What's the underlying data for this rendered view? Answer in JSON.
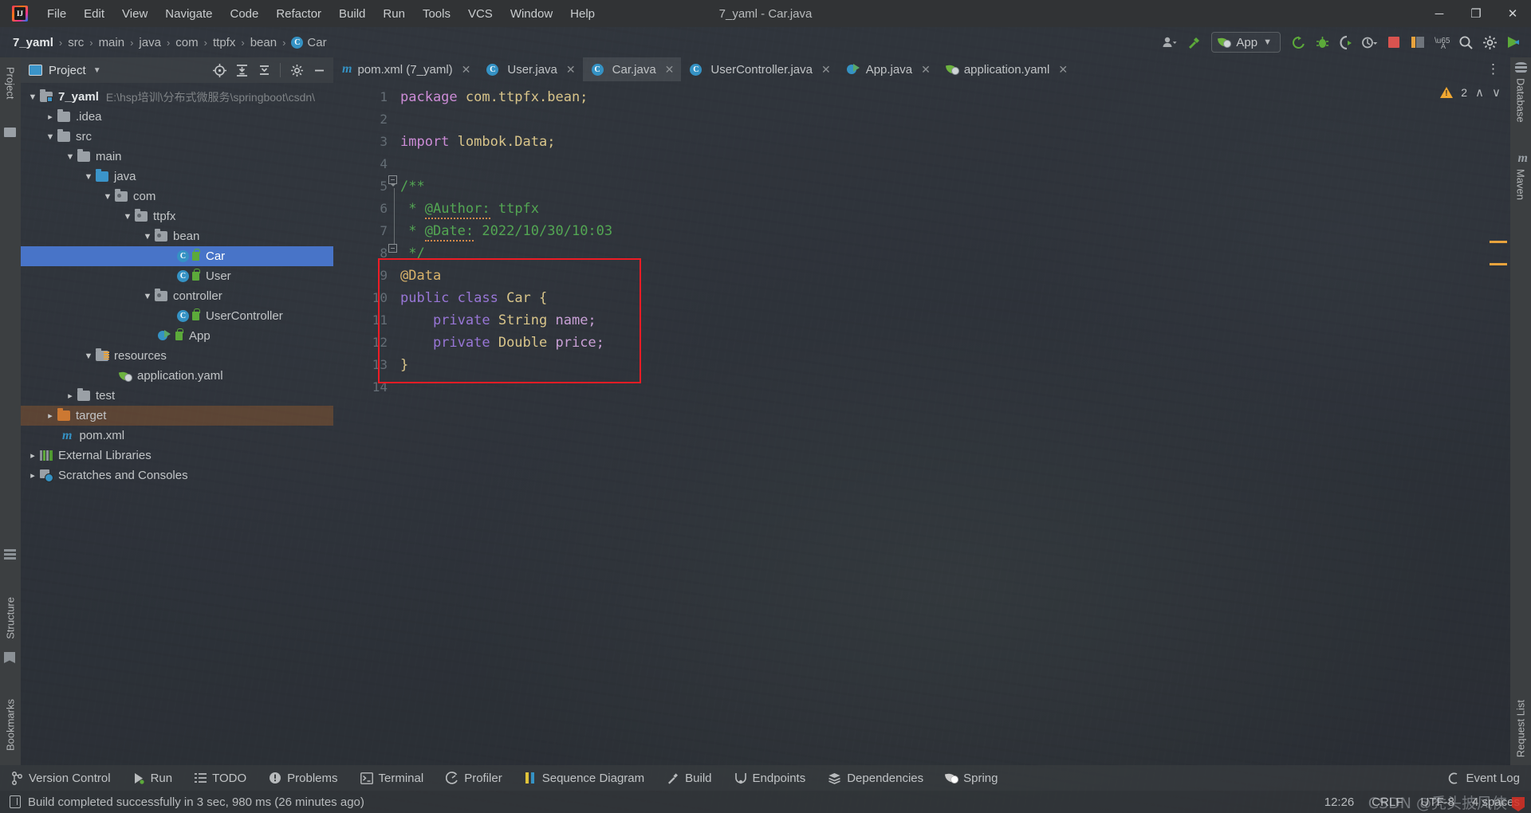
{
  "window": {
    "title": "7_yaml - Car.java",
    "logo_letters": "IJ",
    "minimize": "─",
    "maximize": "❐",
    "close": "✕"
  },
  "menu": [
    {
      "label": "File"
    },
    {
      "label": "Edit"
    },
    {
      "label": "View"
    },
    {
      "label": "Navigate"
    },
    {
      "label": "Code"
    },
    {
      "label": "Refactor"
    },
    {
      "label": "Build"
    },
    {
      "label": "Run"
    },
    {
      "label": "Tools"
    },
    {
      "label": "VCS"
    },
    {
      "label": "Window"
    },
    {
      "label": "Help"
    }
  ],
  "breadcrumb": {
    "sep": "›",
    "items": [
      "7_yaml",
      "src",
      "main",
      "java",
      "com",
      "ttpfx",
      "bean",
      "Car"
    ],
    "class_badge": "C"
  },
  "toolbar": {
    "run_config": "App",
    "dropdown_caret": "▼",
    "icons": [
      "user-avatar-icon",
      "hammer-build-icon",
      "rerun-icon",
      "debug-icon",
      "run-coverage-icon",
      "profile-dropdown-icon",
      "stop-icon",
      "layout-icon",
      "translate-icon",
      "search-everywhere-icon",
      "settings-icon",
      "updates-icon"
    ]
  },
  "left_strip": {
    "project": "Project",
    "structure": "Structure",
    "bookmarks": "Bookmarks"
  },
  "right_strip": {
    "database": "Database",
    "maven": "Maven",
    "request_list": "Request List"
  },
  "project_panel": {
    "title": "Project",
    "chevron": "▼",
    "actions": [
      "select-opened-file-icon",
      "expand-all-icon",
      "collapse-all-icon",
      "settings-icon",
      "hide-icon"
    ]
  },
  "tree": [
    {
      "depth": 0,
      "arrow": "down",
      "icon": "module-folder",
      "label": "7_yaml",
      "path": "E:\\hsp培训\\分布式微服务\\springboot\\csdn\\",
      "bold": true
    },
    {
      "depth": 1,
      "arrow": "right",
      "icon": "folder",
      "label": ".idea"
    },
    {
      "depth": 1,
      "arrow": "down",
      "icon": "folder",
      "label": "src"
    },
    {
      "depth": 2,
      "arrow": "down",
      "icon": "folder",
      "label": "main"
    },
    {
      "depth": 3,
      "arrow": "down",
      "icon": "source-folder",
      "label": "java"
    },
    {
      "depth": 4,
      "arrow": "down",
      "icon": "package",
      "label": "com"
    },
    {
      "depth": 5,
      "arrow": "down",
      "icon": "package",
      "label": "ttpfx"
    },
    {
      "depth": 6,
      "arrow": "down",
      "icon": "package",
      "label": "bean"
    },
    {
      "depth": 7,
      "arrow": "none",
      "icon": "java-class",
      "label": "Car",
      "lock": true,
      "selected": true
    },
    {
      "depth": 7,
      "arrow": "none",
      "icon": "java-class",
      "label": "User",
      "lock": true
    },
    {
      "depth": 6,
      "arrow": "down",
      "icon": "package",
      "label": "controller"
    },
    {
      "depth": 7,
      "arrow": "none",
      "icon": "java-class",
      "label": "UserController",
      "lock": true
    },
    {
      "depth": 6,
      "arrow": "none",
      "icon": "spring-boot-app",
      "label": "App",
      "lock": true
    },
    {
      "depth": 3,
      "arrow": "down",
      "icon": "resource-folder",
      "label": "resources"
    },
    {
      "depth": 4,
      "arrow": "none",
      "icon": "spring-yaml",
      "label": "application.yaml"
    },
    {
      "depth": 2,
      "arrow": "right",
      "icon": "folder",
      "label": "test"
    },
    {
      "depth": 1,
      "arrow": "right",
      "icon": "target-folder",
      "label": "target",
      "excluded": true
    },
    {
      "depth": 1,
      "arrow": "none",
      "icon": "maven-pom",
      "label": "pom.xml"
    },
    {
      "depth": 0,
      "arrow": "right",
      "icon": "libraries",
      "label": "External Libraries"
    },
    {
      "depth": 0,
      "arrow": "right",
      "icon": "scratches",
      "label": "Scratches and Consoles"
    }
  ],
  "editor_tabs": [
    {
      "label": "pom.xml (7_yaml)",
      "icon": "maven-pom",
      "active": false
    },
    {
      "label": "User.java",
      "icon": "java-class",
      "active": false
    },
    {
      "label": "Car.java",
      "icon": "java-class",
      "active": true
    },
    {
      "label": "UserController.java",
      "icon": "java-class",
      "active": false
    },
    {
      "label": "App.java",
      "icon": "spring-boot-app",
      "active": false
    },
    {
      "label": "application.yaml",
      "icon": "spring-yaml",
      "active": false
    }
  ],
  "tab_close_glyph": "✕",
  "inspection": {
    "warning_count": "2",
    "up": "∧",
    "down": "∨"
  },
  "code": {
    "lines": [
      "1",
      "2",
      "3",
      "4",
      "5",
      "6",
      "7",
      "8",
      "9",
      "10",
      "11",
      "12",
      "13",
      "14"
    ],
    "text": {
      "l1_kw": "package",
      "l1_rest": " com.ttpfx.bean;",
      "l3_kw": "import",
      "l3_rest": " lombok.Data;",
      "l5": "/**",
      "l6_star": " * ",
      "l6_tag": "@Author:",
      "l6_val": " ttpfx",
      "l7_star": " * ",
      "l7_tag": "@Date:",
      "l7_val": " 2022/10/30/10:03",
      "l8": " */",
      "l9": "@Data",
      "l10_kw1": "public",
      "l10_kw2": " class",
      "l10_name": " Car",
      "l10_brace": " {",
      "l11_kw": "    private",
      "l11_type": " String",
      "l11_name": " name;",
      "l12_kw": "    private",
      "l12_type": " Double",
      "l12_name": " price;",
      "l13": "}"
    }
  },
  "bottom_tools": [
    {
      "label": "Version Control",
      "icon": "branch-icon"
    },
    {
      "label": "Run",
      "icon": "run-icon"
    },
    {
      "label": "TODO",
      "icon": "todo-list-icon"
    },
    {
      "label": "Problems",
      "icon": "problems-icon"
    },
    {
      "label": "Terminal",
      "icon": "terminal-icon"
    },
    {
      "label": "Profiler",
      "icon": "profiler-icon"
    },
    {
      "label": "Sequence Diagram",
      "icon": "sequence-diagram-icon"
    },
    {
      "label": "Build",
      "icon": "build-hammer-icon"
    },
    {
      "label": "Endpoints",
      "icon": "endpoints-icon"
    },
    {
      "label": "Dependencies",
      "icon": "dependencies-icon"
    },
    {
      "label": "Spring",
      "icon": "spring-leaf-icon"
    }
  ],
  "event_log": {
    "label": "Event Log",
    "icon": "event-log-icon"
  },
  "status": {
    "message": "Build completed successfully in 3 sec, 980 ms (26 minutes ago)",
    "position": "12:26",
    "line_separator": "CRLF",
    "encoding": "UTF-8",
    "indent": "4 spaces",
    "watermark": "CSDN @秃头披风侠"
  },
  "colors": {
    "accent_blue": "#3592c4",
    "selection_blue": "#4874c8",
    "warning_orange": "#f0a732",
    "highlight_red": "#ee1c25",
    "keyword_purple": "#9876d6",
    "string_orange": "#d9a45b",
    "comment_green": "#53a653",
    "green_lock": "#5caa3a"
  }
}
